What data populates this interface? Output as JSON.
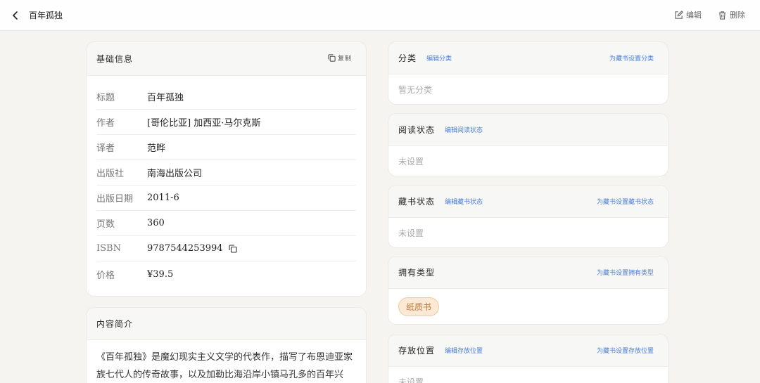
{
  "header": {
    "title": "百年孤独",
    "edit_label": "编辑",
    "delete_label": "删除"
  },
  "basic": {
    "title": "基础信息",
    "copy_label": "复制",
    "rows": [
      {
        "key": "标题",
        "value": "百年孤独"
      },
      {
        "key": "作者",
        "value": "[哥伦比亚] 加西亚·马尔克斯"
      },
      {
        "key": "译者",
        "value": "范晔"
      },
      {
        "key": "出版社",
        "value": "南海出版公司"
      },
      {
        "key": "出版日期",
        "value": "2011-6"
      },
      {
        "key": "页数",
        "value": "360"
      },
      {
        "key": "ISBN",
        "value": "9787544253994"
      },
      {
        "key": "价格",
        "value": "¥39.5"
      }
    ]
  },
  "synopsis": {
    "title": "内容简介",
    "text": "《百年孤独》是魔幻现实主义文学的代表作，描写了布恩迪亚家族七代人的传奇故事，以及加勒比海沿岸小镇马孔多的百年兴"
  },
  "category": {
    "title": "分类",
    "edit_label": "编辑分类",
    "set_label": "为藏书设置分类",
    "value": "暂无分类"
  },
  "reading": {
    "title": "阅读状态",
    "edit_label": "编辑阅读状态",
    "value": "未设置"
  },
  "collection": {
    "title": "藏书状态",
    "edit_label": "编辑藏书状态",
    "set_label": "为藏书设置藏书状态",
    "value": "未设置"
  },
  "ownership": {
    "title": "拥有类型",
    "set_label": "为藏书设置拥有类型",
    "tag": "纸质书"
  },
  "location": {
    "title": "存放位置",
    "edit_label": "编辑存放位置",
    "set_label": "为藏书设置存放位置",
    "value": "未设置"
  },
  "colors": {
    "link": "#4a7fd4",
    "tag_bg": "#fbe9d6",
    "tag_text": "#b97839"
  },
  "icons": [
    "chevron-left-icon",
    "edit-icon",
    "trash-icon",
    "copy-icon"
  ]
}
